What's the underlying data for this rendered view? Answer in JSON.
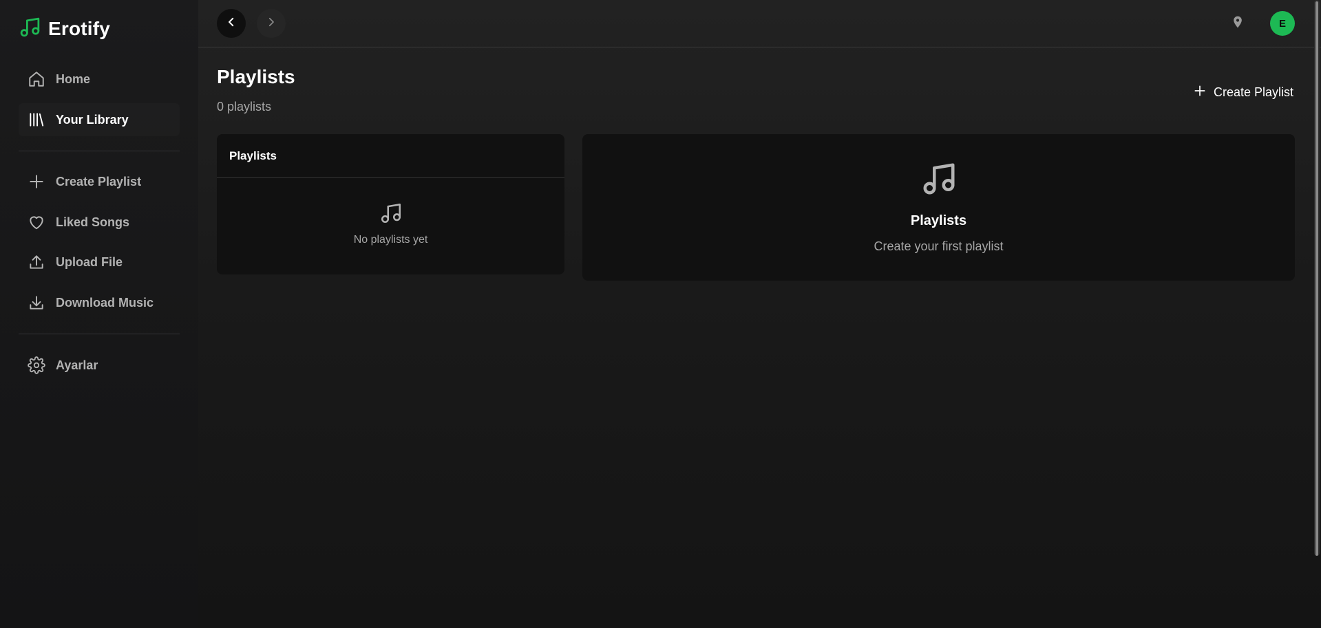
{
  "colors": {
    "accent": "#1db954",
    "sidebar_bg": "#1b1b1c",
    "main_bg": "#1c1c1c",
    "panel_bg": "#111111",
    "text_muted": "#a7a7a7"
  },
  "brand": {
    "name": "Erotify",
    "icon": "music-note-icon"
  },
  "sidebar": {
    "primary": [
      {
        "label": "Home",
        "icon": "home-icon",
        "active": false
      },
      {
        "label": "Your Library",
        "icon": "library-icon",
        "active": true
      }
    ],
    "secondary": [
      {
        "label": "Create Playlist",
        "icon": "plus-icon"
      },
      {
        "label": "Liked Songs",
        "icon": "heart-icon"
      },
      {
        "label": "Upload File",
        "icon": "upload-icon"
      },
      {
        "label": "Download Music",
        "icon": "download-icon"
      }
    ],
    "settings": {
      "label": "Ayarlar",
      "icon": "gear-icon"
    }
  },
  "topbar": {
    "back_icon": "chevron-left-icon",
    "forward_icon": "chevron-right-icon",
    "location_icon": "location-pin-icon",
    "avatar_initial": "E"
  },
  "page": {
    "title": "Playlists",
    "count_text": "0 playlists",
    "create_button": "Create Playlist"
  },
  "list_panel": {
    "header": "Playlists",
    "empty_message": "No playlists yet"
  },
  "detail_panel": {
    "title": "Playlists",
    "subtitle": "Create your first playlist"
  }
}
